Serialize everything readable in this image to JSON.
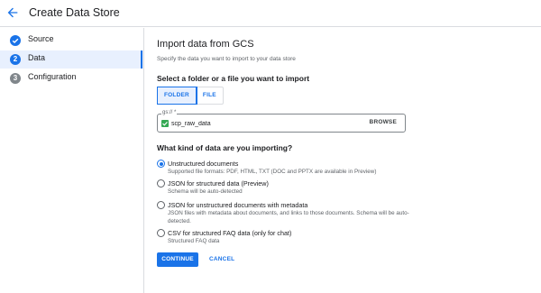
{
  "header": {
    "back_icon": "arrow-left-icon",
    "title": "Create Data Store"
  },
  "colors": {
    "accent": "#1a73e8",
    "step_done": "#1a73e8",
    "step_active": "#1a73e8",
    "step_pending": "#80868b",
    "active_bg": "#e8f0fe"
  },
  "sidebar": {
    "steps": [
      {
        "marker": "check-icon",
        "label": "Source",
        "state": "done"
      },
      {
        "marker": "2",
        "label": "Data",
        "state": "active"
      },
      {
        "marker": "3",
        "label": "Configuration",
        "state": "pending"
      }
    ]
  },
  "main": {
    "heading": "Import data from GCS",
    "subtitle": "Specify the data you want to import to your data store",
    "select_heading": "Select a folder or a file you want to import",
    "toggle": {
      "options": [
        "FOLDER",
        "FILE"
      ],
      "selected": "FOLDER"
    },
    "gcs_field": {
      "label": "gs:// *",
      "value": "scp_raw_data",
      "icon": "bucket-icon",
      "browse_label": "BROWSE"
    },
    "kind_heading": "What kind of data are you importing?",
    "options": [
      {
        "label": "Unstructured documents",
        "description": "Supported file formats: PDF, HTML, TXT (DOC and PPTX are available in Preview)",
        "checked": true
      },
      {
        "label": "JSON for structured data (Preview)",
        "description": "Schema will be auto-detected",
        "checked": false
      },
      {
        "label": "JSON for unstructured documents with metadata",
        "description": "JSON files with metadata about documents, and links to those documents. Schema will be auto-detected.",
        "checked": false
      },
      {
        "label": "CSV for structured FAQ data (only for chat)",
        "description": "Structured FAQ data",
        "checked": false
      }
    ],
    "continue_label": "CONTINUE",
    "cancel_label": "CANCEL"
  }
}
